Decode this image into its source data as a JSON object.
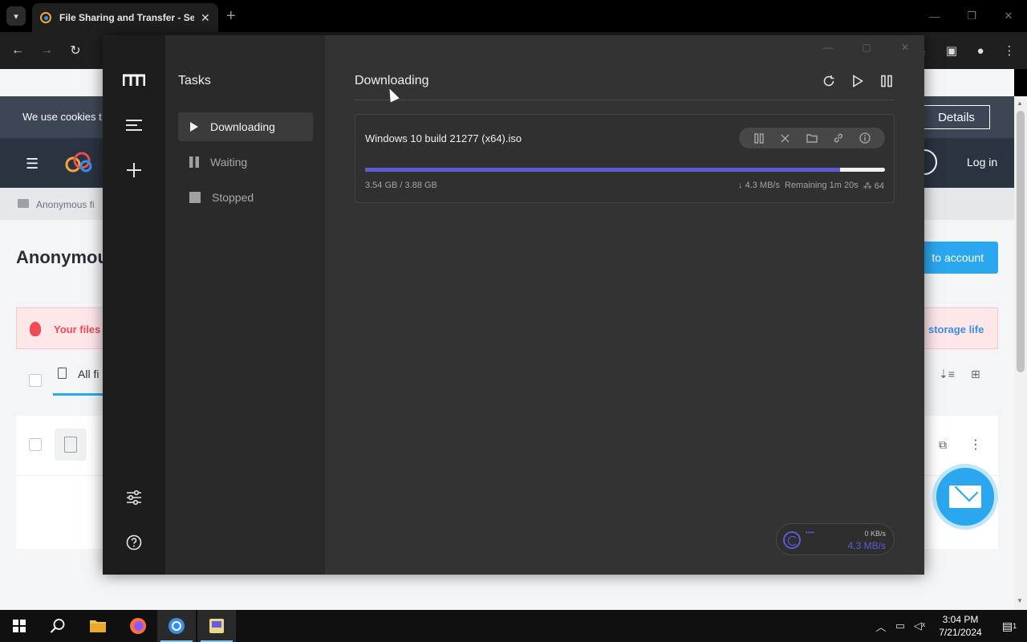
{
  "browser": {
    "tab_title": "File Sharing and Transfer - Send",
    "new_tab_label": "+",
    "window_min": "—",
    "window_restore": "❐",
    "window_close": "✕"
  },
  "website": {
    "cookie_text": "We use cookies t",
    "details_label": "Details",
    "login_label": "Log in",
    "breadcrumb": "Anonymous fi",
    "page_heading": "Anonymou",
    "account_button": "to account",
    "alert_text": "Your files",
    "alert_link": "storage life",
    "all_files_tab": "All fi"
  },
  "app": {
    "sidebar_title": "Tasks",
    "sidebar_items": [
      {
        "label": "Downloading",
        "active": true
      },
      {
        "label": "Waiting",
        "active": false
      },
      {
        "label": "Stopped",
        "active": false
      }
    ],
    "main_title": "Downloading",
    "task": {
      "name": "Windows 10 build 21277 (x64).iso",
      "progress": 0.913,
      "size": "3.54 GB / 3.88 GB",
      "speed": "↓ 4.3 MB/s",
      "remaining": "Remaining 1m 20s",
      "connections": "⁂ 64"
    },
    "speedometer": {
      "limit": "••••",
      "upload": "0 KB/s",
      "download": "4.3 MB/s"
    }
  },
  "taskbar": {
    "time": "3:04 PM",
    "date": "7/21/2024",
    "notification_count": "1"
  },
  "colors": {
    "accent": "#5b5bd6",
    "site_blue": "#2aa7ef",
    "alert_red": "#ef4b55"
  }
}
